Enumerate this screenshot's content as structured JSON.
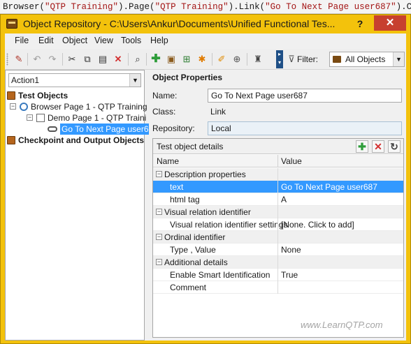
{
  "code_line": {
    "p1": "Browser(",
    "s1": "\"QTP Training\"",
    "p2": ").Page(",
    "s2": "\"QTP Training\"",
    "p3": ").Link(",
    "s3": "\"Go To Next Page user687\"",
    "p4": ").Click"
  },
  "window": {
    "title": "Object Repository - C:\\Users\\Ankur\\Documents\\Unified Functional Tes...",
    "help_label": "?",
    "close_label": "✕"
  },
  "menu": {
    "file": "File",
    "edit": "Edit",
    "object": "Object",
    "view": "View",
    "tools": "Tools",
    "help": "Help"
  },
  "toolbar": {
    "filter_label": "Filter:",
    "filter_value": "All Objects",
    "icons": [
      "edit-script-icon",
      "undo-icon",
      "redo-icon",
      "cut-icon",
      "copy-icon",
      "paste-icon",
      "delete-icon",
      "find-icon",
      "add-object-icon",
      "object-spy-icon",
      "highlight-icon",
      "locate-icon",
      "highlight-pen-icon",
      "target-icon",
      "spy-icon"
    ]
  },
  "left": {
    "action_value": "Action1",
    "tree": {
      "test_objects": "Test Objects",
      "browser": "Browser Page 1 - QTP Training",
      "page": "Demo Page 1 - QTP Traini",
      "link": "Go To Next Page user6",
      "checkpoints": "Checkpoint and Output Objects"
    }
  },
  "right": {
    "section_title": "Object Properties",
    "name_label": "Name:",
    "name_value": "Go To Next Page user687",
    "class_label": "Class:",
    "class_value": "Link",
    "repository_label": "Repository:",
    "repository_value": "Local",
    "details_title": "Test object details",
    "grid_header": {
      "name": "Name",
      "value": "Value"
    },
    "rows": [
      {
        "type": "section",
        "name": "Description properties",
        "value": ""
      },
      {
        "type": "prop",
        "name": "text",
        "value": "Go To Next Page user687",
        "selected": true
      },
      {
        "type": "prop",
        "name": "html tag",
        "value": "A"
      },
      {
        "type": "section",
        "name": "Visual relation identifier",
        "value": ""
      },
      {
        "type": "prop",
        "name": "Visual relation identifier settings",
        "value": "[None. Click to add]"
      },
      {
        "type": "section",
        "name": "Ordinal identifier",
        "value": ""
      },
      {
        "type": "prop",
        "name": "Type , Value",
        "value": "None"
      },
      {
        "type": "section",
        "name": "Additional details",
        "value": ""
      },
      {
        "type": "prop",
        "name": "Enable Smart Identification",
        "value": "True"
      },
      {
        "type": "prop",
        "name": "Comment",
        "value": ""
      }
    ]
  },
  "watermark": "www.LearnQTP.com",
  "colors": {
    "window_frame": "#f3c20c",
    "selection": "#3399ff",
    "close_button": "#c7402f"
  }
}
